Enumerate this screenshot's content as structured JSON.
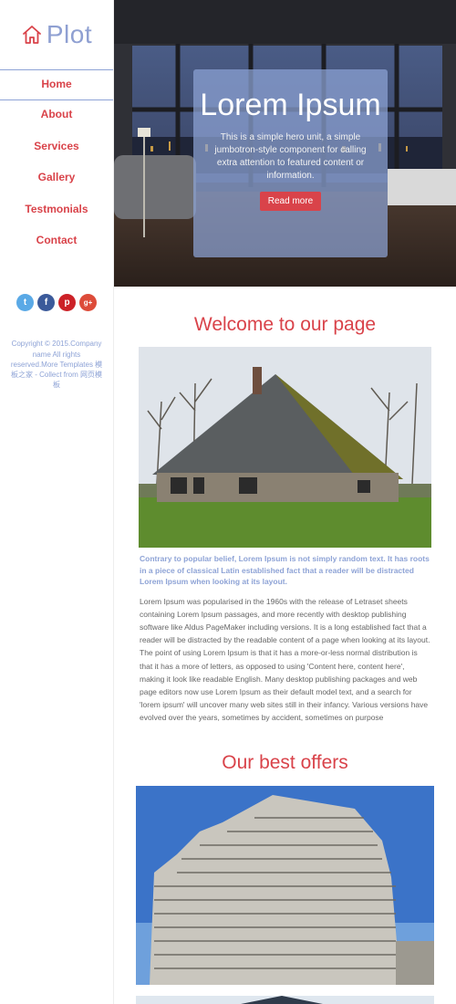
{
  "brand": {
    "name": "Plot",
    "accent": "#d9434a",
    "secondary": "#8ea3d6"
  },
  "nav": {
    "items": [
      {
        "label": "Home",
        "active": true
      },
      {
        "label": "About"
      },
      {
        "label": "Services"
      },
      {
        "label": "Gallery"
      },
      {
        "label": "Testmonials"
      },
      {
        "label": "Contact"
      }
    ]
  },
  "social": [
    {
      "icon": "twitter-icon",
      "glyph": "t",
      "color": "#5aa9e6"
    },
    {
      "icon": "facebook-icon",
      "glyph": "f",
      "color": "#3b5a9a"
    },
    {
      "icon": "pinterest-icon",
      "glyph": "p",
      "color": "#cc2127"
    },
    {
      "icon": "google-plus-icon",
      "glyph": "g+",
      "color": "#dd4b39"
    }
  ],
  "copyright": "Copyright © 2015.Company name All rights reserved.More Templates 模板之家 - Collect from 网页模板",
  "hero": {
    "title": "Lorem Ipsum",
    "text": "This is a simple hero unit, a simple jumbotron-style component for calling extra attention to featured content or information.",
    "button": "Read more"
  },
  "welcome": {
    "title": "Welcome to our page",
    "lead": "Contrary to popular belief, Lorem Ipsum is not simply random text. It has roots in a piece of classical Latin established fact that a reader will be distracted Lorem Ipsum when looking at its layout.",
    "body": "Lorem Ipsum was popularised in the 1960s with the release of Letraset sheets containing Lorem Ipsum passages, and more recently with desktop publishing software like Aldus PageMaker including versions. It is a long established fact that a reader will be distracted by the readable content of a page when looking at its layout. The point of using Lorem Ipsum is that it has a more-or-less normal distribution is that it has a more of letters, as opposed to using 'Content here, content here', making it look like readable English. Many desktop publishing packages and web page editors now use Lorem Ipsum as their default model text, and a search for 'lorem ipsum' will uncover many web sites still in their infancy. Various versions have evolved over the years, sometimes by accident, sometimes on purpose"
  },
  "offers": {
    "title": "Our best offers"
  }
}
